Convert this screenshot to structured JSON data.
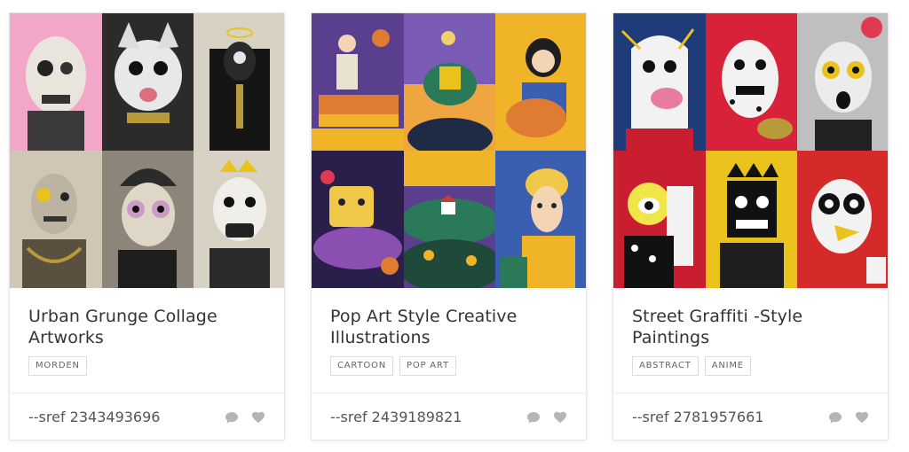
{
  "cards": [
    {
      "title": "Urban Grunge Collage Artworks",
      "tags": [
        "MORDEN"
      ],
      "sref": "--sref 2343493696",
      "palette": [
        "#f2a6c8",
        "#2b2b2b",
        "#1a1a1a",
        "#cfc6b6",
        "#8d8579",
        "#d8d2c4"
      ]
    },
    {
      "title": "Pop Art Style Creative Illustrations",
      "tags": [
        "CARTOON",
        "POP ART"
      ],
      "sref": "--sref 2439189821",
      "palette": [
        "#5a3f8f",
        "#e07b32",
        "#f0b429",
        "#2a1f4a",
        "#7a5bb5",
        "#3b5fb0"
      ]
    },
    {
      "title": "Street Graffiti -Style Paintings",
      "tags": [
        "ABSTRACT",
        "ANIME"
      ],
      "sref": "--sref 2781957661",
      "palette": [
        "#1f3b7a",
        "#d8223a",
        "#bfbfbf",
        "#c81e2f",
        "#e9c21c",
        "#d52a2a"
      ]
    }
  ],
  "icons": {
    "comment": "comment-icon",
    "like": "heart-icon"
  }
}
